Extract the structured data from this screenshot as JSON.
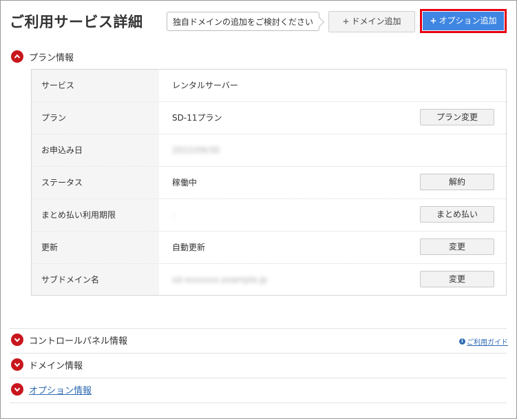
{
  "header": {
    "title": "ご利用サービス詳細",
    "hint": "独自ドメインの追加をご検討ください",
    "add_domain_label": "ドメイン追加",
    "add_option_label": "オプション追加",
    "plus_glyph": "+"
  },
  "plan_section": {
    "label": "プラン情報",
    "rows": [
      {
        "label": "サービス",
        "value": "レンタルサーバー",
        "action": ""
      },
      {
        "label": "プラン",
        "value": "SD-11プラン",
        "action": "プラン変更"
      },
      {
        "label": "お申込み日",
        "value": "2022/09/30",
        "action": ""
      },
      {
        "label": "ステータス",
        "value": "稼働中",
        "action": "解約"
      },
      {
        "label": "まとめ払い利用期限",
        "value": "-",
        "action": "まとめ払い"
      },
      {
        "label": "更新",
        "value": "自動更新",
        "action": "変更"
      },
      {
        "label": "サブドメイン名",
        "value": "sd-xxxxxxx.example.jp",
        "action": "変更"
      }
    ]
  },
  "sections": {
    "control_panel": "コントロールパネル情報",
    "domain": "ドメイン情報",
    "option": "オプション情報"
  },
  "guide_link": "ご利用ガイド",
  "guide_icon_glyph": "i",
  "colors": {
    "accent_red": "#c8161d",
    "highlight_border": "#e60012",
    "primary_blue": "#3f86e3",
    "link_blue": "#2f6bb3"
  }
}
